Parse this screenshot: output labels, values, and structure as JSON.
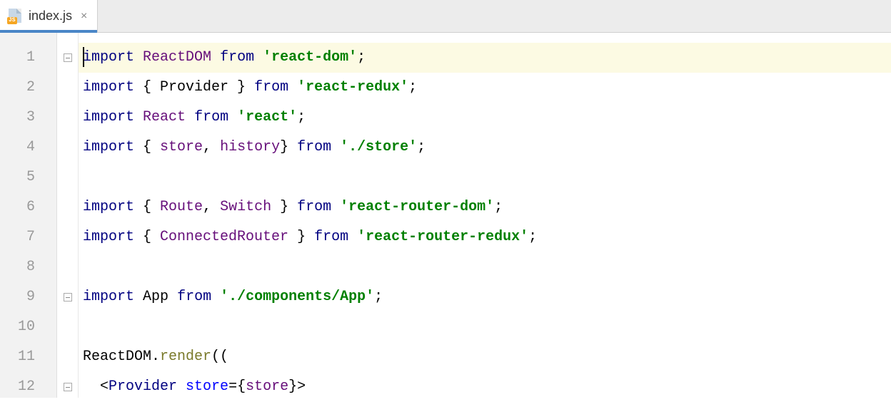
{
  "tab": {
    "label": "index.js",
    "icon_badge": "JS"
  },
  "colors": {
    "keyword": "#000080",
    "class": "#660e7a",
    "string": "#008000",
    "function": "#7a7a2b",
    "attribute": "#0000ff",
    "tab_accent": "#4a86c7",
    "highlighted_line": "#fcfae3"
  },
  "icons": {
    "file": "js-file-icon",
    "close": "×",
    "fold": "fold-minus-icon"
  },
  "lines": [
    {
      "n": 1,
      "highlighted": true,
      "fold": true,
      "tokens": [
        {
          "t": "cursor"
        },
        {
          "t": "kw",
          "v": "import"
        },
        {
          "t": "punc",
          "v": " "
        },
        {
          "t": "cls",
          "v": "ReactDOM"
        },
        {
          "t": "punc",
          "v": " "
        },
        {
          "t": "kw",
          "v": "from"
        },
        {
          "t": "punc",
          "v": " "
        },
        {
          "t": "str",
          "v": "'react-dom'"
        },
        {
          "t": "punc",
          "v": ";"
        }
      ]
    },
    {
      "n": 2,
      "highlighted": false,
      "fold": false,
      "tokens": [
        {
          "t": "kw",
          "v": "import"
        },
        {
          "t": "punc",
          "v": " { "
        },
        {
          "t": "ident",
          "v": "Provider"
        },
        {
          "t": "punc",
          "v": " } "
        },
        {
          "t": "kw",
          "v": "from"
        },
        {
          "t": "punc",
          "v": " "
        },
        {
          "t": "str",
          "v": "'react-redux'"
        },
        {
          "t": "punc",
          "v": ";"
        }
      ]
    },
    {
      "n": 3,
      "highlighted": false,
      "fold": false,
      "tokens": [
        {
          "t": "kw",
          "v": "import"
        },
        {
          "t": "punc",
          "v": " "
        },
        {
          "t": "cls",
          "v": "React"
        },
        {
          "t": "punc",
          "v": " "
        },
        {
          "t": "kw",
          "v": "from"
        },
        {
          "t": "punc",
          "v": " "
        },
        {
          "t": "str",
          "v": "'react'"
        },
        {
          "t": "punc",
          "v": ";"
        }
      ]
    },
    {
      "n": 4,
      "highlighted": false,
      "fold": false,
      "tokens": [
        {
          "t": "kw",
          "v": "import"
        },
        {
          "t": "punc",
          "v": " { "
        },
        {
          "t": "cls",
          "v": "store"
        },
        {
          "t": "punc",
          "v": ", "
        },
        {
          "t": "cls",
          "v": "history"
        },
        {
          "t": "punc",
          "v": "} "
        },
        {
          "t": "kw",
          "v": "from"
        },
        {
          "t": "punc",
          "v": " "
        },
        {
          "t": "str",
          "v": "'./store'"
        },
        {
          "t": "punc",
          "v": ";"
        }
      ]
    },
    {
      "n": 5,
      "highlighted": false,
      "fold": false,
      "tokens": []
    },
    {
      "n": 6,
      "highlighted": false,
      "fold": false,
      "tokens": [
        {
          "t": "kw",
          "v": "import"
        },
        {
          "t": "punc",
          "v": " { "
        },
        {
          "t": "cls",
          "v": "Route"
        },
        {
          "t": "punc",
          "v": ", "
        },
        {
          "t": "cls",
          "v": "Switch"
        },
        {
          "t": "punc",
          "v": " } "
        },
        {
          "t": "kw",
          "v": "from"
        },
        {
          "t": "punc",
          "v": " "
        },
        {
          "t": "str",
          "v": "'react-router-dom'"
        },
        {
          "t": "punc",
          "v": ";"
        }
      ]
    },
    {
      "n": 7,
      "highlighted": false,
      "fold": false,
      "tokens": [
        {
          "t": "kw",
          "v": "import"
        },
        {
          "t": "punc",
          "v": " { "
        },
        {
          "t": "cls",
          "v": "ConnectedRouter"
        },
        {
          "t": "punc",
          "v": " } "
        },
        {
          "t": "kw",
          "v": "from"
        },
        {
          "t": "punc",
          "v": " "
        },
        {
          "t": "str",
          "v": "'react-router-redux'"
        },
        {
          "t": "punc",
          "v": ";"
        }
      ]
    },
    {
      "n": 8,
      "highlighted": false,
      "fold": false,
      "tokens": []
    },
    {
      "n": 9,
      "highlighted": false,
      "fold": true,
      "tokens": [
        {
          "t": "kw",
          "v": "import"
        },
        {
          "t": "punc",
          "v": " "
        },
        {
          "t": "ident",
          "v": "App"
        },
        {
          "t": "punc",
          "v": " "
        },
        {
          "t": "kw",
          "v": "from"
        },
        {
          "t": "punc",
          "v": " "
        },
        {
          "t": "str",
          "v": "'./components/App'"
        },
        {
          "t": "punc",
          "v": ";"
        }
      ]
    },
    {
      "n": 10,
      "highlighted": false,
      "fold": false,
      "tokens": []
    },
    {
      "n": 11,
      "highlighted": false,
      "fold": false,
      "tokens": [
        {
          "t": "ident",
          "v": "ReactDOM"
        },
        {
          "t": "punc",
          "v": "."
        },
        {
          "t": "func",
          "v": "render"
        },
        {
          "t": "punc",
          "v": "(("
        }
      ]
    },
    {
      "n": 12,
      "highlighted": false,
      "fold": true,
      "tokens": [
        {
          "t": "punc",
          "v": "  <"
        },
        {
          "t": "jsx",
          "v": "Provider"
        },
        {
          "t": "punc",
          "v": " "
        },
        {
          "t": "attr",
          "v": "store"
        },
        {
          "t": "punc",
          "v": "={"
        },
        {
          "t": "cls",
          "v": "store"
        },
        {
          "t": "punc",
          "v": "}>"
        }
      ]
    }
  ]
}
